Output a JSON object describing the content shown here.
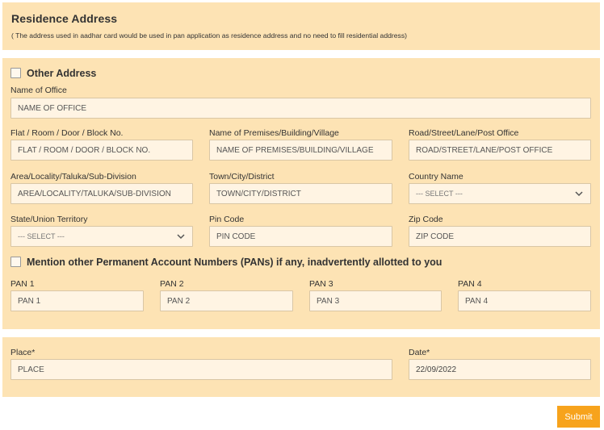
{
  "residence": {
    "title": "Residence Address",
    "note": "( The address used in aadhar card would be used in pan application as residence address and no need to fill residential address)"
  },
  "other_address": {
    "checkbox_label": "Other Address",
    "office": {
      "label": "Name of Office",
      "placeholder": "NAME OF OFFICE"
    },
    "flat": {
      "label": "Flat / Room / Door / Block No.",
      "placeholder": "FLAT / ROOM / DOOR / BLOCK NO."
    },
    "premises": {
      "label": "Name of Premises/Building/Village",
      "placeholder": "NAME OF PREMISES/BUILDING/VILLAGE"
    },
    "road": {
      "label": "Road/Street/Lane/Post Office",
      "placeholder": "ROAD/STREET/LANE/POST OFFICE"
    },
    "area": {
      "label": "Area/Locality/Taluka/Sub-Division",
      "placeholder": "AREA/LOCALITY/TALUKA/SUB-DIVISION"
    },
    "town": {
      "label": "Town/City/District",
      "placeholder": "TOWN/CITY/DISTRICT"
    },
    "country": {
      "label": "Country Name",
      "selected": "--- SELECT ---"
    },
    "state": {
      "label": "State/Union Territory",
      "selected": "--- SELECT ---"
    },
    "pin": {
      "label": "Pin Code",
      "placeholder": "PIN CODE"
    },
    "zip": {
      "label": "Zip Code",
      "placeholder": "ZIP CODE"
    }
  },
  "pans": {
    "checkbox_label": "Mention other Permanent Account Numbers (PANs) if any, inadvertently allotted to you",
    "items": [
      {
        "label": "PAN 1",
        "placeholder": "PAN 1"
      },
      {
        "label": "PAN 2",
        "placeholder": "PAN 2"
      },
      {
        "label": "PAN 3",
        "placeholder": "PAN 3"
      },
      {
        "label": "PAN 4",
        "placeholder": "PAN 4"
      }
    ]
  },
  "signature": {
    "place": {
      "label": "Place*",
      "placeholder": "PLACE"
    },
    "date": {
      "label": "Date*",
      "value": "22/09/2022"
    }
  },
  "submit_label": "Submit",
  "colors": {
    "panel": "#fde3b4",
    "field": "#fff4e3",
    "accent": "#f7a31c"
  }
}
